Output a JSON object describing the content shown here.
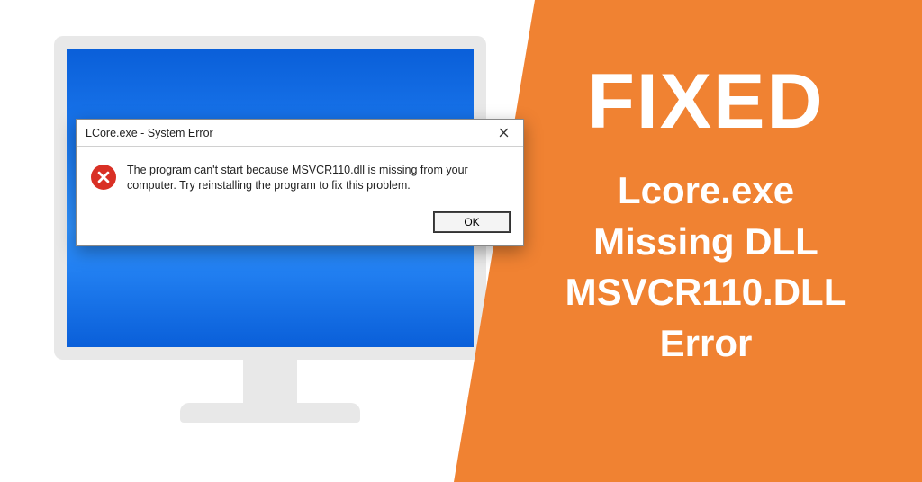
{
  "banner": {
    "fixed_label": "FIXED",
    "subtitle_line1": "Lcore.exe",
    "subtitle_line2": "Missing DLL",
    "subtitle_line3": "MSVCR110.DLL",
    "subtitle_line4": "Error"
  },
  "dialog": {
    "title": "LCore.exe - System Error",
    "message": "The program can't start because MSVCR110.dll is missing from your computer. Try reinstalling the program to fix this problem.",
    "ok_label": "OK",
    "icon_name": "error-icon",
    "close_name": "close-icon"
  },
  "colors": {
    "accent_orange": "#f08232",
    "desktop_blue": "#1d7bf0",
    "error_red": "#d93025"
  }
}
